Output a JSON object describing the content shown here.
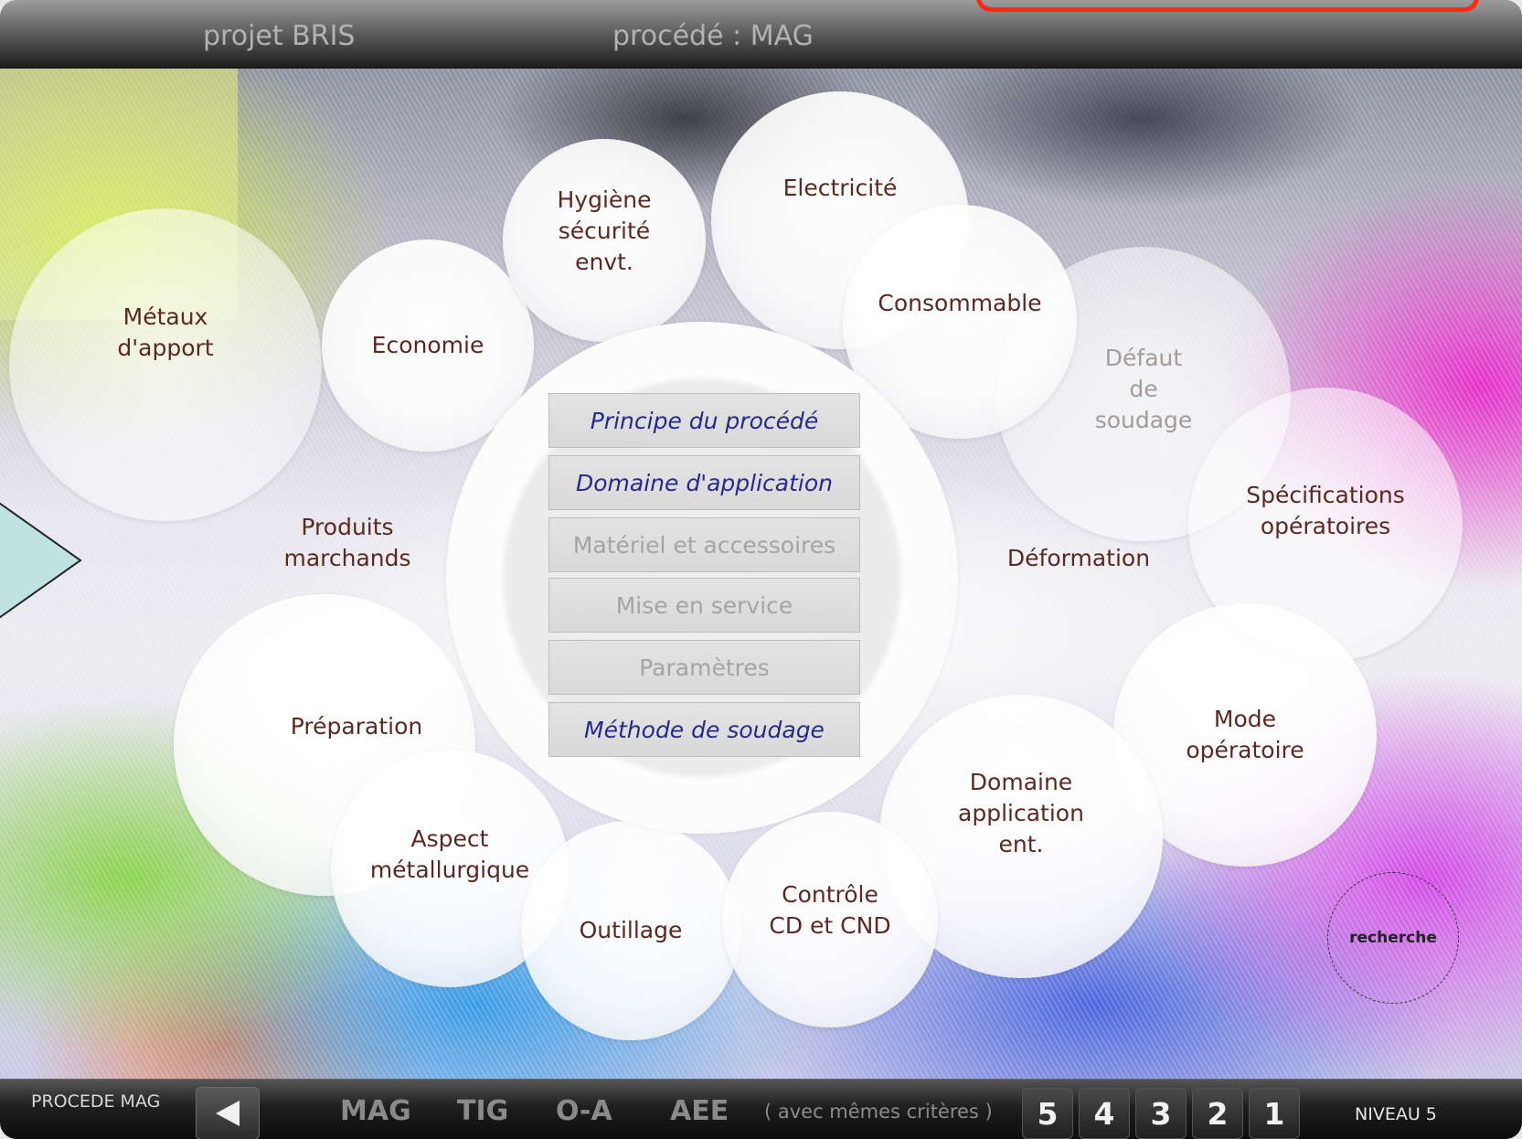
{
  "header": {
    "project": "projet BRIS",
    "process": "procédé : MAG"
  },
  "bubbles": {
    "hygiene": "Hygiène\nsécurité\nenvt.",
    "electricite": "Electricité",
    "economie": "Economie",
    "consommable": "Consommable",
    "metaux": "Métaux\nd'apport",
    "defaut": "Défaut\nde\nsoudage",
    "specifications": "Spécifications\nopératoires",
    "produits": "Produits\nmarchands",
    "deformation": "Déformation",
    "preparation": "Préparation",
    "mode": "Mode\nopératoire",
    "domaine_app": "Domaine\napplication\nent.",
    "aspect": "Aspect\nmétallurgique",
    "outillage": "Outillage",
    "controle": "Contrôle\nCD et CND"
  },
  "menu": [
    {
      "label": "Principe du procédé",
      "state": "active"
    },
    {
      "label": "Domaine d'application",
      "state": "active"
    },
    {
      "label": "Matériel et accessoires",
      "state": "inactive"
    },
    {
      "label": "Mise en service",
      "state": "inactive"
    },
    {
      "label": "Paramètres",
      "state": "inactive"
    },
    {
      "label": "Méthode de soudage",
      "state": "active"
    }
  ],
  "search": {
    "label": "recherche"
  },
  "footer": {
    "procede_label": "PROCEDE MAG",
    "tabs": [
      "MAG",
      "TIG",
      "O-A",
      "AEE"
    ],
    "criteria": "( avec mêmes critères )",
    "levels": [
      "5",
      "4",
      "3",
      "2",
      "1"
    ],
    "niveau": "NIVEAU 5"
  },
  "colors": {
    "accent_arrow": "#bfe3e3",
    "active_menu_text": "#262a8a",
    "bubble_text": "#5a2a22",
    "bracket": "#ff2a10"
  },
  "icons": {
    "back": "left-triangle-icon",
    "side": "right-arrow-icon"
  }
}
